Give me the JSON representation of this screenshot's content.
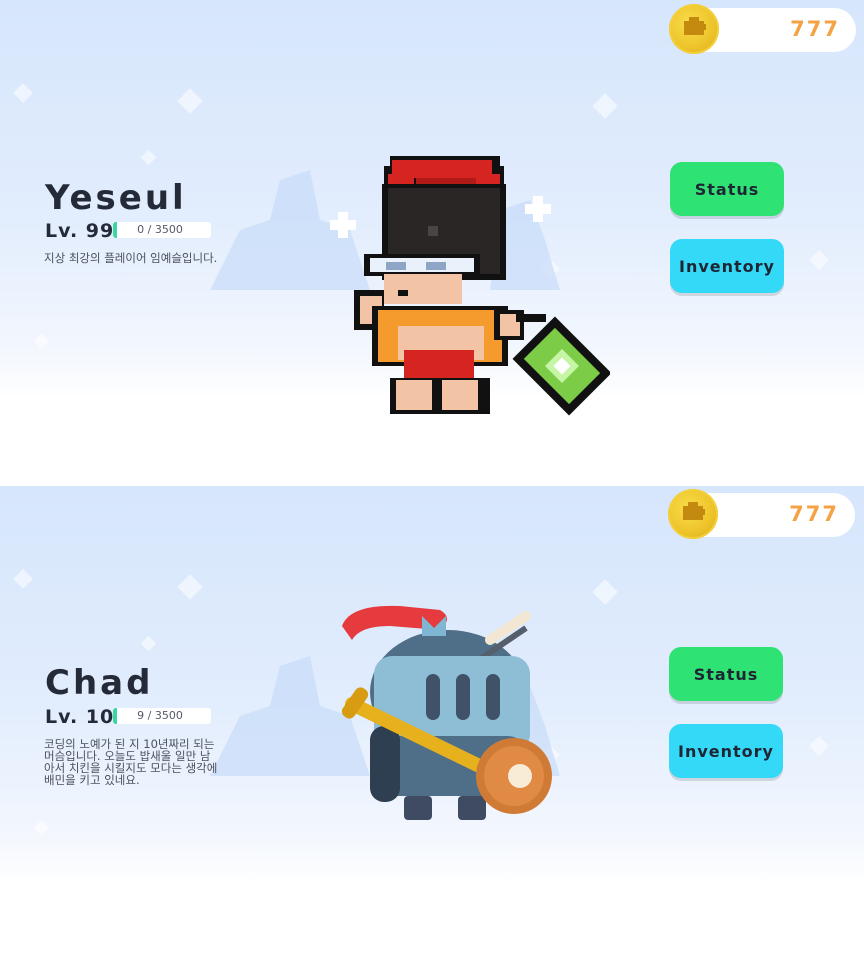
{
  "coins": {
    "icon": "coin-icon",
    "count": "777"
  },
  "buttons": {
    "status": "Status",
    "inventory": "Inventory"
  },
  "characters": [
    {
      "name": "Yeseul",
      "level": "Lv. 99",
      "xp_text": "0 / 3500",
      "xp_fraction": 0.0,
      "description": [
        "지상 최강의 플레이어 임예슬입니다."
      ],
      "sprite": "pixel-hero-sprite"
    },
    {
      "name": "Chad",
      "level": "Lv. 10",
      "xp_text": "9 / 3500",
      "xp_fraction": 0.003,
      "description": [
        "코딩의 노예가 된 지 10년짜리 되는",
        "머슴입니다. 오늘도 밥새울 일만 남",
        "아서 치킨을 시킬지도 모다는 생각에",
        "배민을 키고 있네요."
      ],
      "sprite": "knight-sprite"
    }
  ],
  "colors": {
    "status_button": "#2fe274",
    "inventory_button": "#33d9f7",
    "xp_fill": "#3ad7a3",
    "coin_text": "#f3a344"
  }
}
